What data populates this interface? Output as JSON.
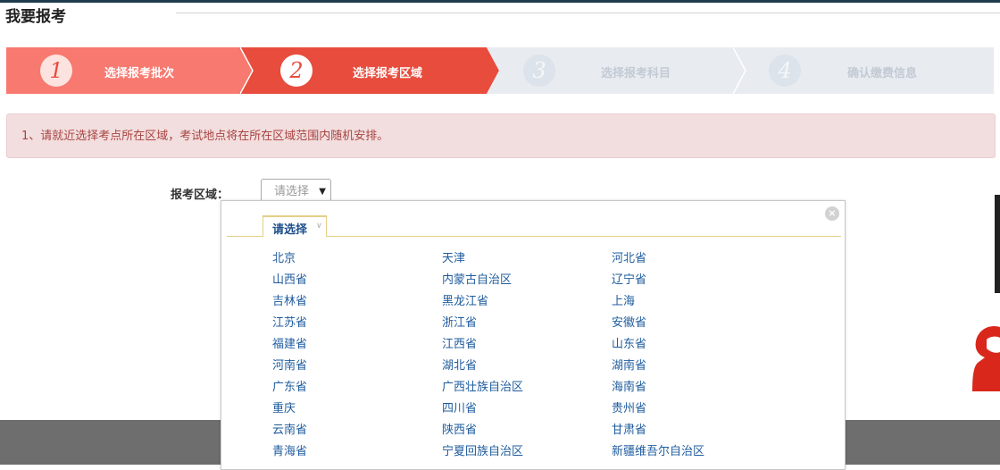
{
  "page": {
    "title": "我要报考"
  },
  "steps": [
    {
      "number": "1",
      "label": "选择报考批次"
    },
    {
      "number": "2",
      "label": "选择报考区域"
    },
    {
      "number": "3",
      "label": "选择报考科目"
    },
    {
      "number": "4",
      "label": "确认缴费信息"
    }
  ],
  "notice": "1、请就近选择考点所在区域，考试地点将在所在区域范围内随机安排。",
  "region": {
    "label": "报考区域：",
    "select_value": "请选择"
  },
  "popup": {
    "tab_label": "请选择",
    "close_symbol": "×",
    "provinces": [
      "北京",
      "天津",
      "河北省",
      "山西省",
      "内蒙古自治区",
      "辽宁省",
      "吉林省",
      "黑龙江省",
      "上海",
      "江苏省",
      "浙江省",
      "安徽省",
      "福建省",
      "江西省",
      "山东省",
      "河南省",
      "湖北省",
      "湖南省",
      "广东省",
      "广西壮族自治区",
      "海南省",
      "重庆",
      "四川省",
      "贵州省",
      "云南省",
      "陕西省",
      "甘肃省",
      "青海省",
      "宁夏回族自治区",
      "新疆维吾尔自治区"
    ]
  },
  "colors": {
    "step_done": "#f7796f",
    "step_active": "#e84c3d",
    "step_pending": "#e8ecf1",
    "link": "#1f5c9e"
  }
}
